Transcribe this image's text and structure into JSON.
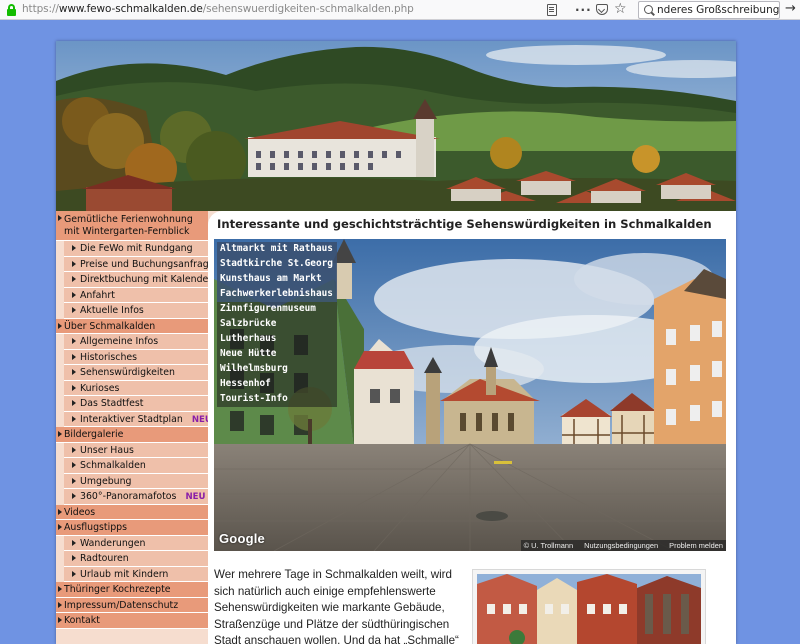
{
  "browser": {
    "url_scheme": "https://",
    "url_host": "www.fewo-schmalkalden.de",
    "url_path": "/sehenswuerdigkeiten-schmalkalden.php",
    "search_value": "nderes Großschreibung"
  },
  "nav": {
    "items": [
      {
        "label": "Gemütliche Ferienwohnung mit Wintergarten-Fernblick",
        "level": "top"
      },
      {
        "label": "Die FeWo mit Rundgang",
        "level": "sub"
      },
      {
        "label": "Preise und Buchungsanfrage",
        "level": "sub"
      },
      {
        "label": "Direktbuchung mit Kalender",
        "level": "sub"
      },
      {
        "label": "Anfahrt",
        "level": "sub"
      },
      {
        "label": "Aktuelle Infos",
        "level": "sub"
      },
      {
        "label": "Über Schmalkalden",
        "level": "top"
      },
      {
        "label": "Allgemeine Infos",
        "level": "sub"
      },
      {
        "label": "Historisches",
        "level": "sub"
      },
      {
        "label": "Sehenswürdigkeiten",
        "level": "sub"
      },
      {
        "label": "Kurioses",
        "level": "sub"
      },
      {
        "label": "Das Stadtfest",
        "level": "sub"
      },
      {
        "label": "Interaktiver Stadtplan",
        "level": "sub",
        "badge": "NEU"
      },
      {
        "label": "Bildergalerie",
        "level": "top"
      },
      {
        "label": "Unser Haus",
        "level": "sub"
      },
      {
        "label": "Schmalkalden",
        "level": "sub"
      },
      {
        "label": "Umgebung",
        "level": "sub"
      },
      {
        "label": "360°-Panoramafotos",
        "level": "sub",
        "badge": "NEU"
      },
      {
        "label": "Videos",
        "level": "top"
      },
      {
        "label": "Ausflugstipps",
        "level": "top"
      },
      {
        "label": "Wanderungen",
        "level": "sub"
      },
      {
        "label": "Radtouren",
        "level": "sub"
      },
      {
        "label": "Urlaub mit Kindern",
        "level": "sub"
      },
      {
        "label": "Thüringer Kochrezepte",
        "level": "top"
      },
      {
        "label": "Impressum/Datenschutz",
        "level": "top"
      },
      {
        "label": "Kontakt",
        "level": "top"
      }
    ]
  },
  "content": {
    "title": "Interessante und geschichtsträchtige Sehenswürdigkeiten in Schmalkalden",
    "poi_list": [
      {
        "label": "Altmarkt mit Rathaus",
        "style": "blue"
      },
      {
        "label": "Stadtkirche St.Georg",
        "style": "blue"
      },
      {
        "label": "Kunsthaus am Markt",
        "style": "blue"
      },
      {
        "label": "Fachwerkerlebnishaus",
        "style": "blue"
      },
      {
        "label": "Zinnfigurenmuseum",
        "style": "dark"
      },
      {
        "label": "Salzbrücke",
        "style": "dark"
      },
      {
        "label": "Lutherhaus",
        "style": "dark"
      },
      {
        "label": "Neue Hütte",
        "style": "dark"
      },
      {
        "label": "Wilhelmsburg",
        "style": "dark"
      },
      {
        "label": "Hessenhof",
        "style": "dark"
      },
      {
        "label": "Tourist-Info",
        "style": "dark"
      }
    ],
    "map": {
      "logo": "Google",
      "copyright": "© U. Trollmann",
      "terms": "Nutzungsbedingungen",
      "report": "Problem melden"
    },
    "intro_text": "Wer mehrere Tage in Schmalkalden weilt, wird sich natürlich auch einige empfehlenswerte Sehenswürdigkeiten wie markante Gebäude, Straßenzüge und Plätze der südthüringischen Stadt anschauen wollen. Und da hat „Schmalle“"
  },
  "colors": {
    "page_background": "#6f93e3",
    "nav_top": "#e89a7a",
    "nav_sub": "#efc0aa",
    "nav_badge": "#8a1ea8",
    "poi_blue": "#3a5070"
  }
}
